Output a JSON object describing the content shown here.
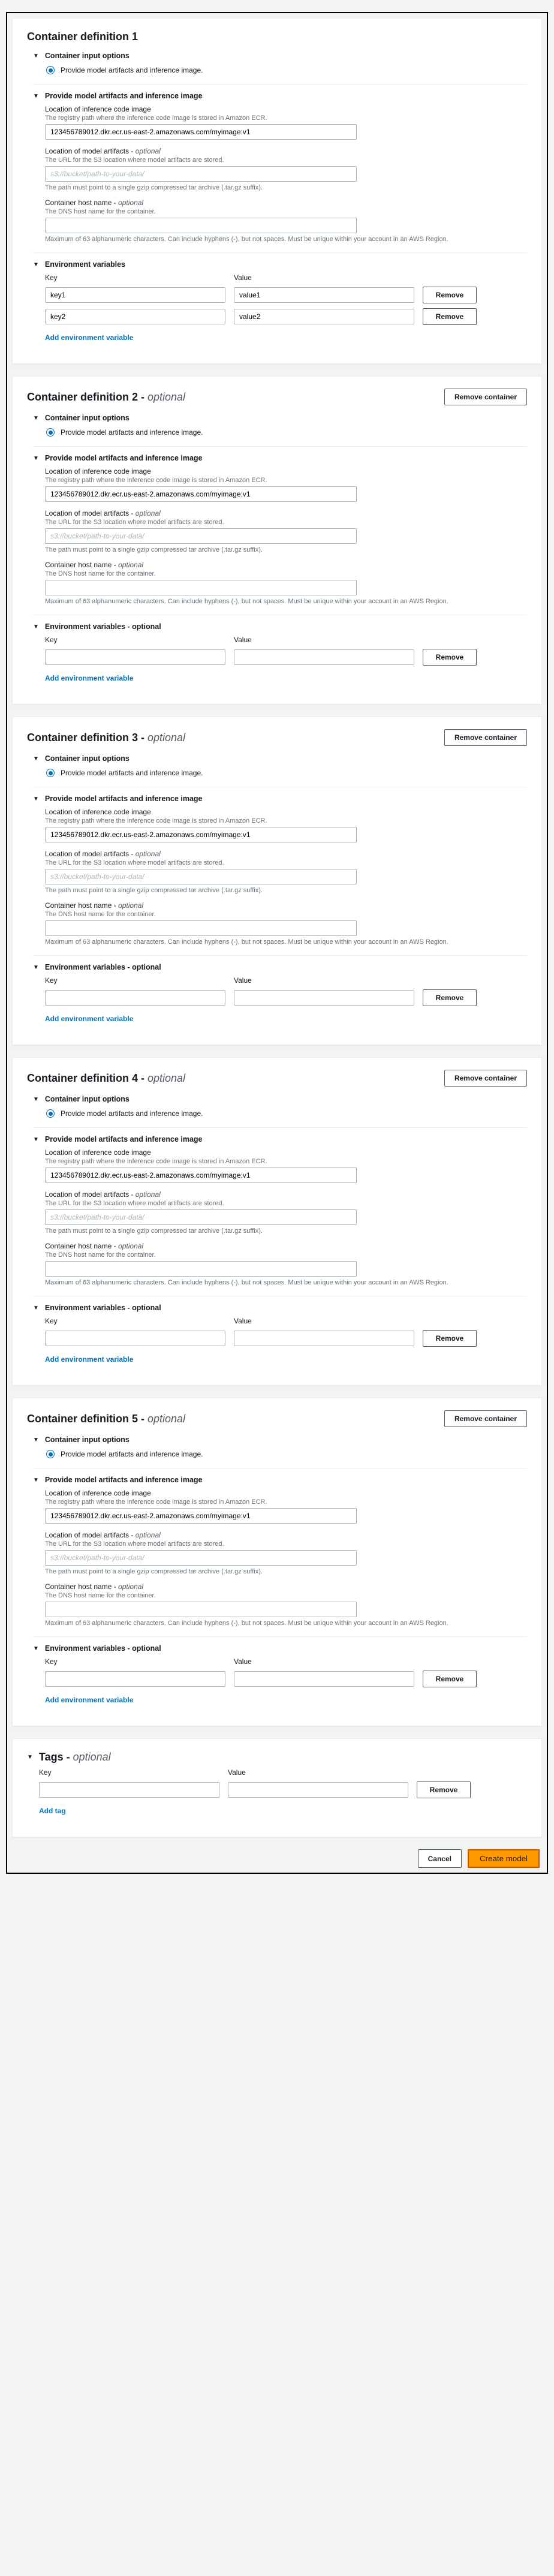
{
  "labels": {
    "container_prefix": "Container definition ",
    "optional": "optional",
    "remove_container": "Remove container",
    "container_input_options": "Container input options",
    "provide_artifacts_opt": "Provide model artifacts and inference image.",
    "provide_artifacts_section": "Provide model artifacts and inference image",
    "loc_image": "Location of inference code image",
    "loc_image_desc": "The registry path where the inference code image is stored in Amazon ECR.",
    "loc_artifacts": "Location of model artifacts - ",
    "loc_artifacts_desc": "The URL for the S3 location where model artifacts are stored.",
    "artifacts_placeholder": "s3://bucket/path-to-your-data/",
    "artifacts_note": "The path must point to a single gzip compressed tar archive (.tar.gz suffix).",
    "host_name": "Container host name - ",
    "host_desc": "The DNS host name for the container.",
    "host_note": "Maximum of 63 alphanumeric characters. Can include hyphens (-), but not spaces. Must be unique within your account in an AWS Region.",
    "env_vars": "Environment variables",
    "env_vars_opt": "Environment variables - ",
    "key": "Key",
    "value": "Value",
    "remove": "Remove",
    "add_env": "Add environment variable",
    "tags": "Tags - ",
    "add_tag": "Add tag",
    "cancel": "Cancel",
    "create_model": "Create model"
  },
  "image_value": "123456789012.dkr.ecr.us-east-2.amazonaws.com/myimage:v1",
  "containers": [
    {
      "n": "1",
      "removable": false,
      "env": [
        {
          "k": "key1",
          "v": "value1"
        },
        {
          "k": "key2",
          "v": "value2"
        }
      ],
      "env_opt": false
    },
    {
      "n": "2",
      "removable": true,
      "env": [
        {
          "k": "",
          "v": ""
        }
      ],
      "env_opt": true
    },
    {
      "n": "3",
      "removable": true,
      "env": [
        {
          "k": "",
          "v": ""
        }
      ],
      "env_opt": true
    },
    {
      "n": "4",
      "removable": true,
      "env": [
        {
          "k": "",
          "v": ""
        }
      ],
      "env_opt": true
    },
    {
      "n": "5",
      "removable": true,
      "env": [
        {
          "k": "",
          "v": ""
        }
      ],
      "env_opt": true
    }
  ],
  "tag_row": {
    "k": "",
    "v": ""
  }
}
